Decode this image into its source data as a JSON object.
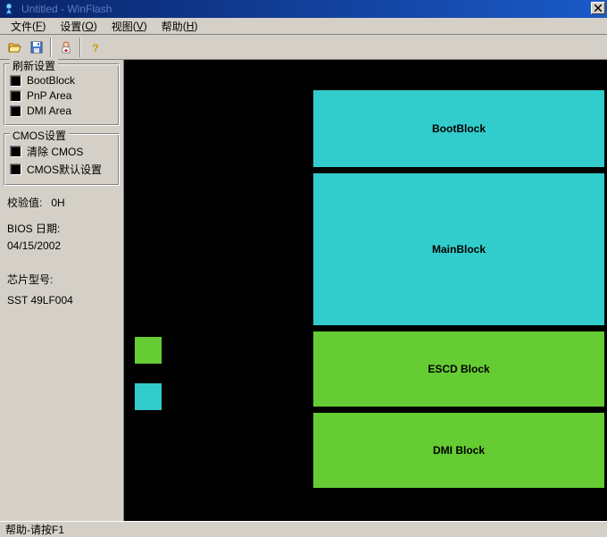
{
  "title": "Untitled - WinFlash",
  "menu": {
    "file": {
      "label": "文件",
      "accel": "F"
    },
    "settings": {
      "label": "设置",
      "accel": "O"
    },
    "view": {
      "label": "视图",
      "accel": "V"
    },
    "help": {
      "label": "帮助",
      "accel": "H"
    }
  },
  "sidebar": {
    "refresh_title": "刷新设置",
    "bootblock": "BootBlock",
    "pnp_area": "PnP Area",
    "dmi_area": "DMI Area",
    "cmos_title": "CMOS设置",
    "clear_cmos": "清除 CMOS",
    "cmos_default": "CMOS默认设置",
    "checksum_label": "校验值:",
    "checksum_value": "0H",
    "bios_date_label": "BIOS 日期:",
    "bios_date_value": "04/15/2002",
    "chip_label": "芯片型号:",
    "chip_value": "SST 49LF004"
  },
  "blocks": {
    "boot": "BootBlock",
    "main": "MainBlock",
    "escd": "ESCD Block",
    "dmi": "DMI Block"
  },
  "status": "帮助-请按F1",
  "colors": {
    "cyan": "#33cccc",
    "green": "#66cc33"
  }
}
